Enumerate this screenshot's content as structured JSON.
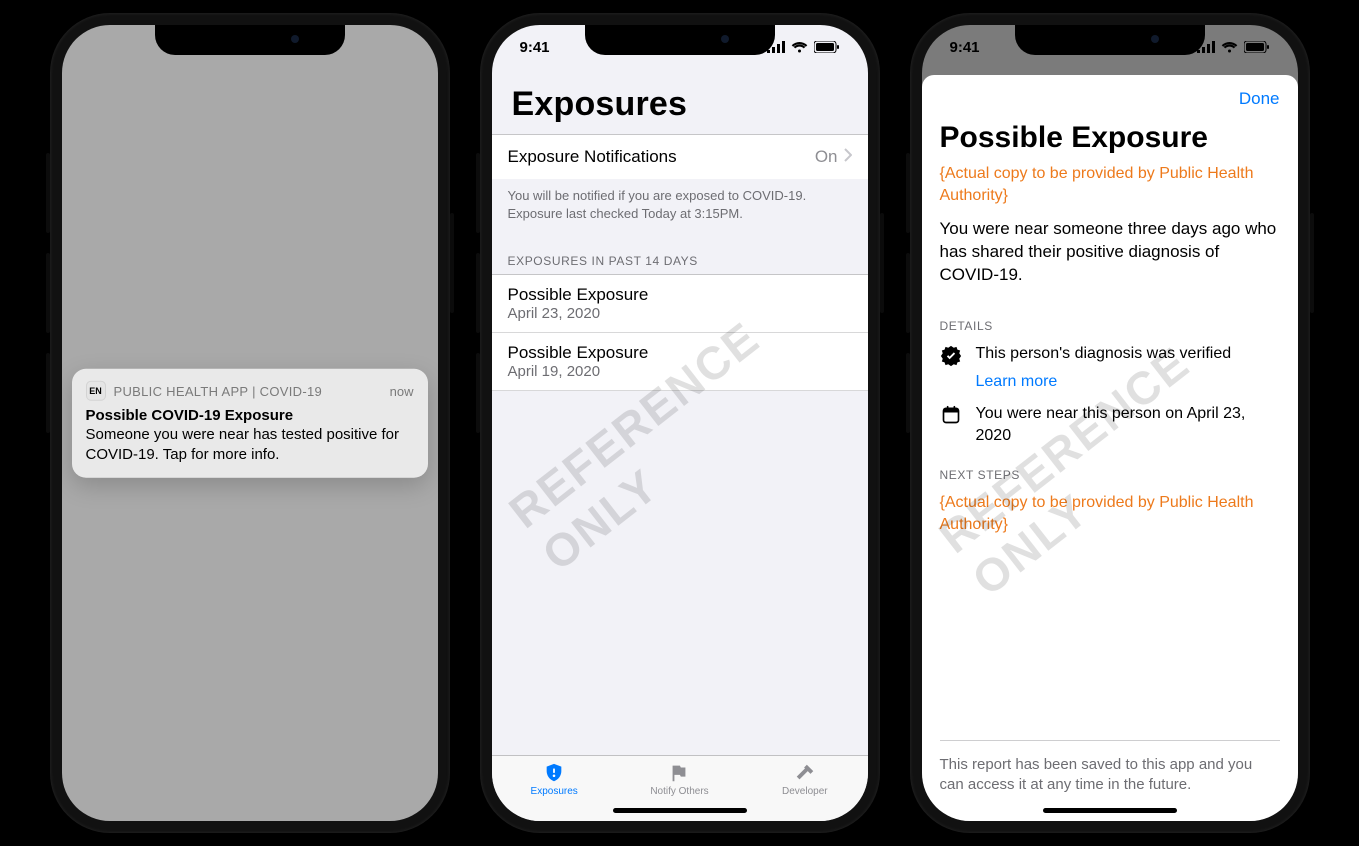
{
  "status": {
    "time": "9:41"
  },
  "watermark": "REFERENCE ONLY",
  "phone1": {
    "notification": {
      "icon_letters": "EN",
      "app_name": "PUBLIC HEALTH APP | COVID-19",
      "time": "now",
      "title": "Possible COVID-19 Exposure",
      "body": "Someone you were near has tested positive for COVID-19. Tap for more info."
    }
  },
  "phone2": {
    "header_title": "Exposures",
    "notif_row": {
      "label": "Exposure Notifications",
      "value": "On"
    },
    "notif_footer": "You will be notified if you are exposed to COVID-19. Exposure last checked Today at 3:15PM.",
    "section_header": "EXPOSURES IN PAST 14 DAYS",
    "exposures": [
      {
        "title": "Possible Exposure",
        "date": "April 23, 2020"
      },
      {
        "title": "Possible Exposure",
        "date": "April 19, 2020"
      }
    ],
    "tabs": [
      {
        "label": "Exposures",
        "active": true
      },
      {
        "label": "Notify Others",
        "active": false
      },
      {
        "label": "Developer",
        "active": false
      }
    ]
  },
  "phone3": {
    "done": "Done",
    "title": "Possible Exposure",
    "placeholder_top": "{Actual copy to be provided by Public Health Authority}",
    "body": "You were near someone three days ago who has shared their positive diagnosis of COVID-19.",
    "details_label": "DETAILS",
    "detail_verified": "This person's diagnosis was verified",
    "learn_more": "Learn more",
    "detail_date": "You were near this person on April 23, 2020",
    "next_steps_label": "NEXT STEPS",
    "placeholder_next": "{Actual copy to be provided by Public Health Authority}",
    "footer": "This report has been saved to this app and you can access it at any time in the future."
  }
}
